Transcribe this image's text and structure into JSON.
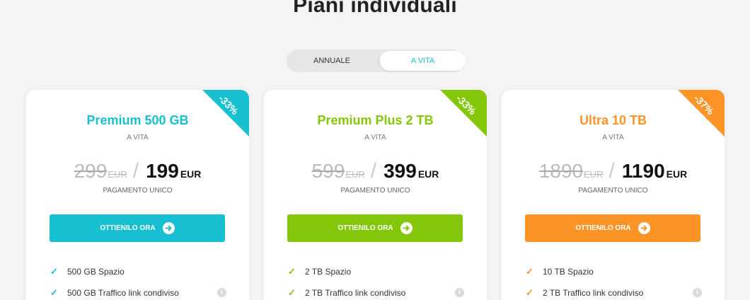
{
  "title": "Piani individuali",
  "toggle": {
    "annual": "ANNUALE",
    "lifetime": "A VITA",
    "selected": "lifetime"
  },
  "colors": {
    "teal": "#17bfd0",
    "green": "#84c60a",
    "orange": "#fd9428"
  },
  "plans": [
    {
      "name": "Premium 500 GB",
      "period": "A VITA",
      "discount": "-33%",
      "old_price": "299",
      "old_currency": "EUR",
      "price": "199",
      "currency": "EUR",
      "payment": "PAGAMENTO UNICO",
      "cta": "OTTIENILO ORA",
      "accent": "#17bfd0",
      "features": [
        "500 GB Spazio",
        "500 GB Traffico link condiviso"
      ]
    },
    {
      "name": "Premium Plus 2 TB",
      "period": "A VITA",
      "discount": "-33%",
      "old_price": "599",
      "old_currency": "EUR",
      "price": "399",
      "currency": "EUR",
      "payment": "PAGAMENTO UNICO",
      "cta": "OTTIENILO ORA",
      "accent": "#84c60a",
      "features": [
        "2 TB Spazio",
        "2 TB Traffico link condiviso"
      ]
    },
    {
      "name": "Ultra 10 TB",
      "period": "A VITA",
      "discount": "-37%",
      "old_price": "1890",
      "old_currency": "EUR",
      "price": "1190",
      "currency": "EUR",
      "payment": "PAGAMENTO UNICO",
      "cta": "OTTIENILO ORA",
      "accent": "#fd9428",
      "features": [
        "10 TB Spazio",
        "2 TB Traffico link condiviso"
      ]
    }
  ],
  "icons": {
    "check": "check-icon",
    "arrow": "arrow-right-circle-icon",
    "info": "info-icon"
  }
}
